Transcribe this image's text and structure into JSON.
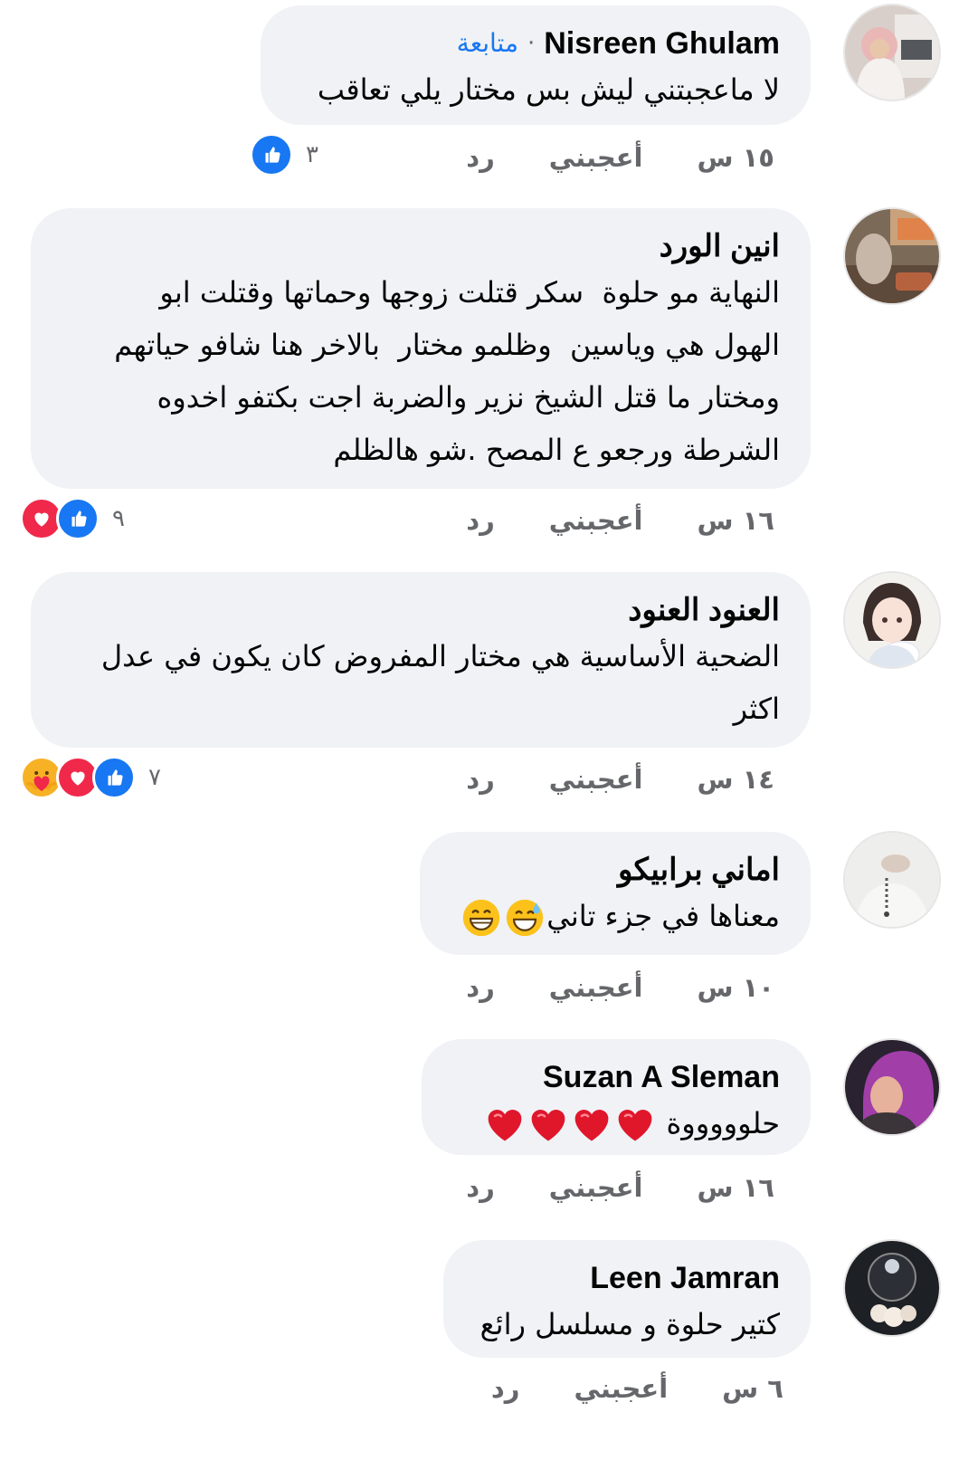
{
  "comments": [
    {
      "author": "Nisreen Ghulam",
      "separator": "·",
      "follow_label": "متابعة",
      "text": "لا ماعجبتني ليش بس مختار يلي تعاقب",
      "time": "١٥ س",
      "like_label": "أعجبني",
      "reply_label": "رد",
      "reaction_count": "٣",
      "reactions": [
        "like-icon"
      ]
    },
    {
      "author": "انين الورد",
      "text": "النهاية مو حلوة  سكر قتلت زوجها وحماتها وقتلت ابو\nالهول هي وياسين  وظلمو مختار  بالاخر هنا شافو حياتهم\nومختار ما قتل الشيخ نزير والضربة اجت بكتفو اخدوه\nالشرطة ورجعو ع المصح .شو هالظلم",
      "time": "١٦ س",
      "like_label": "أعجبني",
      "reply_label": "رد",
      "reaction_count": "٩",
      "reactions": [
        "love-icon",
        "like-icon"
      ]
    },
    {
      "author": "العنود العنود",
      "text": "الضحية الأساسية هي مختار المفروض كان يكون في عدل\nاكثر",
      "time": "١٤ س",
      "like_label": "أعجبني",
      "reply_label": "رد",
      "reaction_count": "٧",
      "reactions": [
        "care-icon",
        "love-icon",
        "like-icon"
      ]
    },
    {
      "author": "اماني برابيكو",
      "text": "معناها في جزء تاني",
      "emojis": [
        "sweat-smile-emoji",
        "grin-emoji"
      ],
      "time": "١٠ س",
      "like_label": "أعجبني",
      "reply_label": "رد"
    },
    {
      "author": "Suzan A Sleman",
      "text": "حلوووووة",
      "emojis": [
        "heart-emoji",
        "heart-emoji",
        "heart-emoji",
        "heart-emoji"
      ],
      "time": "١٦ س",
      "like_label": "أعجبني",
      "reply_label": "رد"
    },
    {
      "author": "Leen Jamran",
      "text": "كتير حلوة و مسلسل رائع",
      "time": "٦ س",
      "like_label": "أعجبني",
      "reply_label": "رد"
    }
  ],
  "colors": {
    "bubble": "#f0f2f5",
    "meta": "#65676b",
    "link": "#1877f2",
    "like": "#1877f2",
    "love": "#f0284a",
    "care": "#f7b125"
  }
}
